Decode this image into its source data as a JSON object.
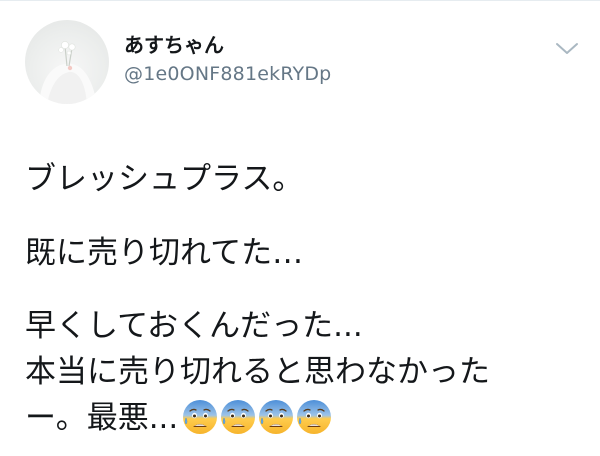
{
  "user": {
    "display_name": "あすちゃん",
    "handle": "@1e0ONF881ekRYDp"
  },
  "tweet": {
    "line1": "ブレッシュプラス。",
    "line2": "既に売り切れてた…",
    "line3": "早くしておくんだった...",
    "line4": "本当に売り切れると思わなかった",
    "line5": "ー。最悪...",
    "emojis": [
      "anxious-face-with-sweat",
      "anxious-face-with-sweat",
      "anxious-face-with-sweat",
      "anxious-face-with-sweat"
    ]
  },
  "icons": {
    "menu_caret": "chevron-down-icon"
  },
  "colors": {
    "text": "#14171a",
    "secondary": "#657786",
    "caret": "#aab8c2"
  }
}
